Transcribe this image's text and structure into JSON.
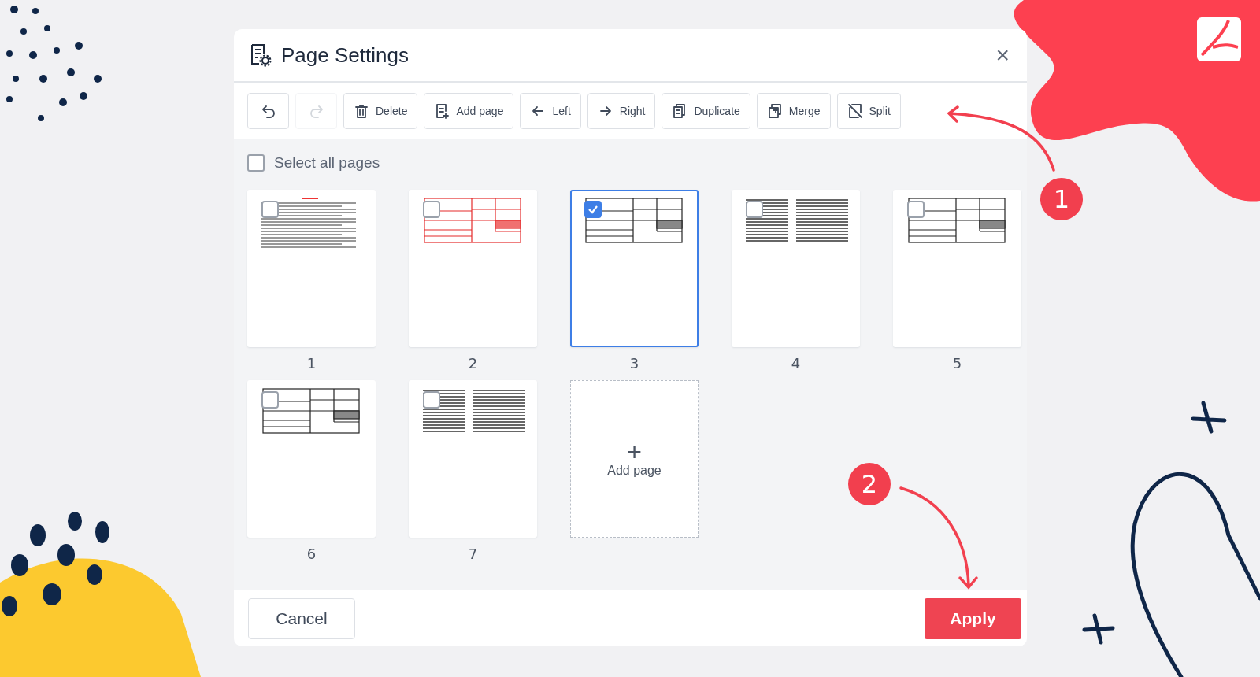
{
  "dialog": {
    "title": "Page Settings",
    "close": "×"
  },
  "toolbar": [
    {
      "disabled": false
    },
    {
      "disabled": true
    },
    {
      "label": "Delete",
      "disabled": false
    },
    {
      "label": "Add page",
      "disabled": false
    },
    {
      "label": "Left",
      "disabled": false
    },
    {
      "label": "Right",
      "disabled": false
    },
    {
      "label": "Duplicate",
      "disabled": false
    },
    {
      "label": "Merge",
      "disabled": false
    },
    {
      "label": "Split",
      "disabled": false
    }
  ],
  "select_all": {
    "label": "Select all pages",
    "checked": false
  },
  "pages": [
    {
      "number": "1",
      "selected": false,
      "kind": "letter"
    },
    {
      "number": "2",
      "selected": false,
      "kind": "red-form"
    },
    {
      "number": "3",
      "selected": true,
      "kind": "form"
    },
    {
      "number": "4",
      "selected": false,
      "kind": "columns"
    },
    {
      "number": "5",
      "selected": false,
      "kind": "form"
    },
    {
      "number": "6",
      "selected": false,
      "kind": "form"
    },
    {
      "number": "7",
      "selected": false,
      "kind": "columns"
    }
  ],
  "add_tile": {
    "plus": "+",
    "label": "Add page"
  },
  "footer": {
    "cancel": "Cancel",
    "apply": "Apply"
  },
  "callouts": [
    "1",
    "2"
  ]
}
